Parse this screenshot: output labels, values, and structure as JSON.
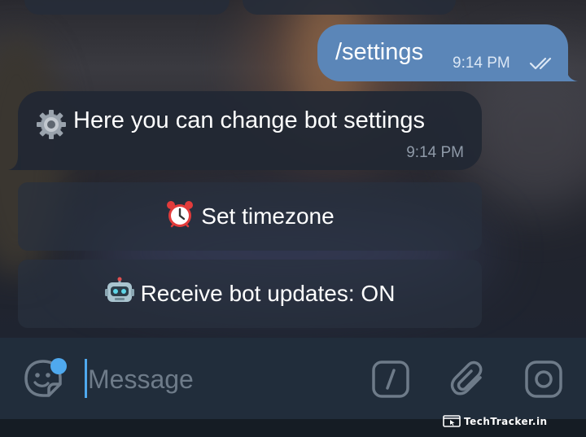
{
  "chat": {
    "outgoing": {
      "text": "/settings",
      "time": "9:14 PM",
      "status_icon": "double-check-icon"
    },
    "incoming": {
      "icon": "gear-emoji",
      "text": "Here you can change bot settings",
      "time": "9:14 PM"
    },
    "keyboard": [
      {
        "icon": "alarm-clock-emoji",
        "label": "Set timezone"
      },
      {
        "icon": "robot-emoji",
        "label": "Receive bot updates: ON"
      }
    ]
  },
  "input_bar": {
    "placeholder": "Message",
    "icons": [
      "sticker-icon",
      "slash-command-icon",
      "paperclip-icon",
      "camera-icon"
    ]
  },
  "watermark": {
    "text": "TechTracker.in"
  },
  "colors": {
    "outgoing_bubble": "#5b86b8",
    "incoming_bubble": "#222834",
    "input_bar": "#212d3b",
    "accent": "#4fa9ee",
    "secondary_text": "#8f9aa8"
  }
}
